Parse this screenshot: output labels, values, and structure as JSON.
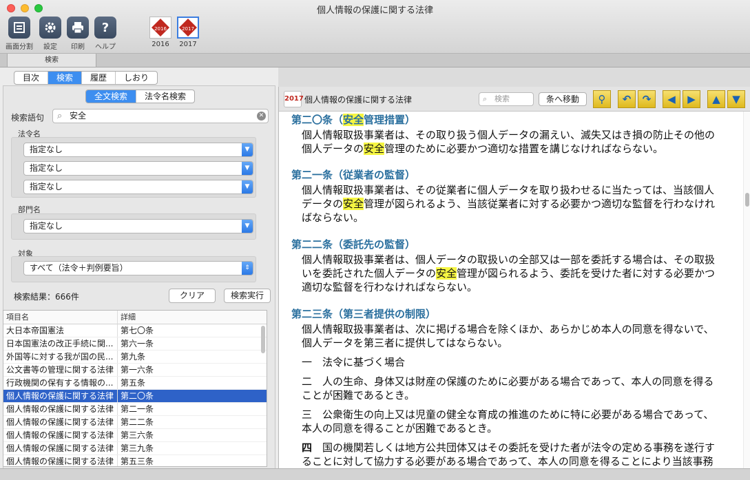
{
  "window": {
    "title": "個人情報の保護に関する法律"
  },
  "toolbar": {
    "buttons": [
      {
        "label": "画面分割",
        "icon": "split-view-icon"
      },
      {
        "label": "設定",
        "icon": "gear-icon"
      },
      {
        "label": "印刷",
        "icon": "printer-icon"
      },
      {
        "label": "ヘルプ",
        "icon": "help-icon"
      }
    ],
    "books": [
      {
        "year": "2016",
        "cover": "模範六法 2016"
      },
      {
        "year": "2017",
        "cover": "模範六法 2017"
      }
    ]
  },
  "doc_tab": "検索",
  "nav_tabs": [
    "目次",
    "検索",
    "履歴",
    "しおり"
  ],
  "search_mode": [
    "全文検索",
    "法令名検索"
  ],
  "form": {
    "query_label": "検索語句",
    "query_value": "安全",
    "law_label": "法令名",
    "law_options": [
      "指定なし",
      "指定なし",
      "指定なし"
    ],
    "dept_label": "部門名",
    "dept_value": "指定なし",
    "target_label": "対象",
    "target_value": "すべて（法令＋判例要旨）",
    "result_count": "検索結果：666件",
    "clear_button": "クリア",
    "search_button": "検索実行"
  },
  "results": {
    "headers": [
      "項目名",
      "詳細"
    ],
    "rows": [
      [
        "大日本帝国憲法",
        "第七〇条"
      ],
      [
        "日本国憲法の改正手続に関...",
        "第六一条"
      ],
      [
        "外国等に対する我が国の民...",
        "第九条"
      ],
      [
        "公文書等の管理に関する法律",
        "第一六条"
      ],
      [
        "行政機関の保有する情報の...",
        "第五条"
      ],
      [
        "個人情報の保護に関する法律",
        "第二〇条"
      ],
      [
        "個人情報の保護に関する法律",
        "第二一条"
      ],
      [
        "個人情報の保護に関する法律",
        "第二二条"
      ],
      [
        "個人情報の保護に関する法律",
        "第三六条"
      ],
      [
        "個人情報の保護に関する法律",
        "第三九条"
      ],
      [
        "個人情報の保護に関する法律",
        "第五三条"
      ]
    ],
    "selected_index": 5
  },
  "viewer": {
    "badge": "2017",
    "title": "個人情報の保護に関する法律",
    "search_placeholder": "検索",
    "jump_label": "条へ移動",
    "buttons": [
      "magnifier-icon",
      "back-arrow-icon",
      "forward-arrow-icon",
      "prev-article-icon",
      "next-article-icon",
      "up-icon",
      "down-icon"
    ]
  },
  "articles": [
    {
      "heading": "第二〇条（安全管理措置）",
      "heading_parts": [
        "第二〇条（",
        "安全",
        "管理措置）"
      ],
      "parts": [
        "個人情報取扱事業者は、その取り扱う個人データの漏えい、滅失又はき損の防止その他の個人データの",
        "安全",
        "管理のために必要かつ適切な措置を講じなければならない。"
      ]
    },
    {
      "heading": "第二一条（従業者の監督）",
      "parts": [
        "個人情報取扱事業者は、その従業者に個人データを取り扱わせるに当たっては、当該個人データの",
        "安全",
        "管理が図られるよう、当該従業者に対する必要かつ適切な監督を行わなければならない。"
      ]
    },
    {
      "heading": "第二二条（委託先の監督）",
      "parts": [
        "個人情報取扱事業者は、個人データの取扱いの全部又は一部を委託する場合は、その取扱いを委託された個人データの",
        "安全",
        "管理が図られるよう、委託を受けた者に対する必要かつ適切な監督を行わなければならない。"
      ]
    },
    {
      "heading": "第二三条（第三者提供の制限）",
      "body": "個人情報取扱事業者は、次に掲げる場合を除くほか、あらかじめ本人の同意を得ないで、個人データを第三者に提供してはならない。",
      "items": [
        {
          "num": "一",
          "text": "法令に基づく場合"
        },
        {
          "num": "二",
          "text": "人の生命、身体又は財産の保護のために必要がある場合であって、本人の同意を得ることが困難であるとき。"
        },
        {
          "num": "三",
          "text": "公衆衛生の向上又は児童の健全な育成の推進のために特に必要がある場合であって、本人の同意を得ることが困難であるとき。"
        },
        {
          "num": "四",
          "text": "国の機関若しくは地方公共団体又はその委託を受けた者が法令の定める事務を遂行することに対して協力する必要がある場合であって、本人の同意を得ることにより当該事務の遂行に支障を及ぼすおそれがあるとき。"
        }
      ]
    }
  ]
}
